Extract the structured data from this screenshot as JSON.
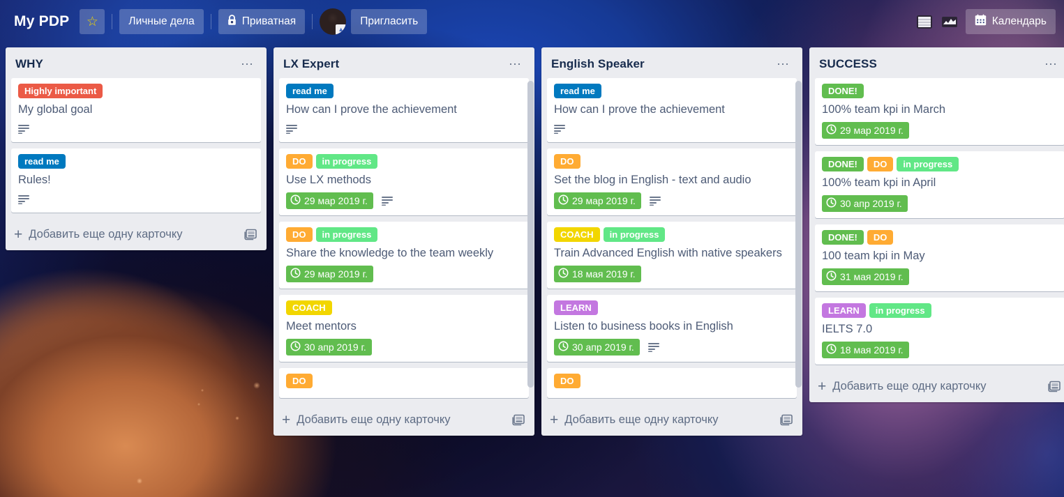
{
  "header": {
    "board_title": "My PDP",
    "star_icon": "star-icon",
    "team_button": "Личные дела",
    "visibility_button": "Приватная",
    "visibility_icon": "lock-icon",
    "invite_button": "Пригласить",
    "avatar": "user-avatar",
    "board_view_icon": "board-view-icon",
    "chart_icon": "chart-icon",
    "calendar_button": "Календарь",
    "calendar_icon": "calendar-icon"
  },
  "labels_palette": {
    "highly_important": "#eb5a46",
    "read_me": "#0079bf",
    "do": "#ffab33",
    "in_progress": "#61e786",
    "coach": "#f2d600",
    "learn": "#c377e0",
    "done": "#61bd4f",
    "due_green": "#61bd4f"
  },
  "add_card_text": "Добавить еще одну карточку",
  "lists": [
    {
      "title": "WHY",
      "menu_icon": "list-menu-icon",
      "scrollbar": false,
      "cards": [
        {
          "labels": [
            {
              "text": "Highly important",
              "color": "#eb5a46"
            }
          ],
          "title": "My global goal",
          "due": null,
          "has_description": true
        },
        {
          "labels": [
            {
              "text": "read me",
              "color": "#0079bf"
            }
          ],
          "title": "Rules!",
          "due": null,
          "has_description": true
        }
      ]
    },
    {
      "title": "LX Expert",
      "menu_icon": "list-menu-icon",
      "scrollbar": true,
      "cards": [
        {
          "labels": [
            {
              "text": "read me",
              "color": "#0079bf"
            }
          ],
          "title": "How can I prove the achievement",
          "due": null,
          "has_description": true
        },
        {
          "labels": [
            {
              "text": "DO",
              "color": "#ffab33"
            },
            {
              "text": "in progress",
              "color": "#61e786"
            }
          ],
          "title": "Use LX methods",
          "due": "29 мар 2019 г.",
          "has_description": true
        },
        {
          "labels": [
            {
              "text": "DO",
              "color": "#ffab33"
            },
            {
              "text": "in progress",
              "color": "#61e786"
            }
          ],
          "title": "Share the knowledge to the team weekly",
          "due": "29 мар 2019 г.",
          "has_description": false
        },
        {
          "labels": [
            {
              "text": "COACH",
              "color": "#f2d600"
            }
          ],
          "title": "Meet mentors",
          "due": "30 апр 2019 г.",
          "has_description": false
        },
        {
          "labels": [
            {
              "text": "DO",
              "color": "#ffab33"
            }
          ],
          "title": "",
          "due": null,
          "has_description": false
        }
      ]
    },
    {
      "title": "English Speaker",
      "menu_icon": "list-menu-icon",
      "scrollbar": true,
      "cards": [
        {
          "labels": [
            {
              "text": "read me",
              "color": "#0079bf"
            }
          ],
          "title": "How can I prove the achievement",
          "due": null,
          "has_description": true
        },
        {
          "labels": [
            {
              "text": "DO",
              "color": "#ffab33"
            }
          ],
          "title": "Set the blog in English - text and audio",
          "due": "29 мар 2019 г.",
          "has_description": true
        },
        {
          "labels": [
            {
              "text": "COACH",
              "color": "#f2d600"
            },
            {
              "text": "in progress",
              "color": "#61e786"
            }
          ],
          "title": "Train Advanced English with native speakers",
          "due": "18 мая 2019 г.",
          "has_description": false
        },
        {
          "labels": [
            {
              "text": "LEARN",
              "color": "#c377e0"
            }
          ],
          "title": "Listen to business books in English",
          "due": "30 апр 2019 г.",
          "has_description": true
        },
        {
          "labels": [
            {
              "text": "DO",
              "color": "#ffab33"
            }
          ],
          "title": "",
          "due": null,
          "has_description": false
        }
      ]
    },
    {
      "title": "SUCCESS",
      "menu_icon": "list-menu-icon",
      "scrollbar": false,
      "cards": [
        {
          "labels": [
            {
              "text": "DONE!",
              "color": "#61bd4f"
            }
          ],
          "title": "100% team kpi in March",
          "due": "29 мар 2019 г.",
          "has_description": false
        },
        {
          "labels": [
            {
              "text": "DONE!",
              "color": "#61bd4f"
            },
            {
              "text": "DO",
              "color": "#ffab33"
            },
            {
              "text": "in progress",
              "color": "#61e786"
            }
          ],
          "title": "100% team kpi in April",
          "due": "30 апр 2019 г.",
          "has_description": false
        },
        {
          "labels": [
            {
              "text": "DONE!",
              "color": "#61bd4f"
            },
            {
              "text": "DO",
              "color": "#ffab33"
            }
          ],
          "title": "100 team kpi in May",
          "due": "31 мая 2019 г.",
          "has_description": false
        },
        {
          "labels": [
            {
              "text": "LEARN",
              "color": "#c377e0"
            },
            {
              "text": "in progress",
              "color": "#61e786"
            }
          ],
          "title": "IELTS 7.0",
          "due": "18 мая 2019 г.",
          "has_description": false
        }
      ]
    }
  ]
}
